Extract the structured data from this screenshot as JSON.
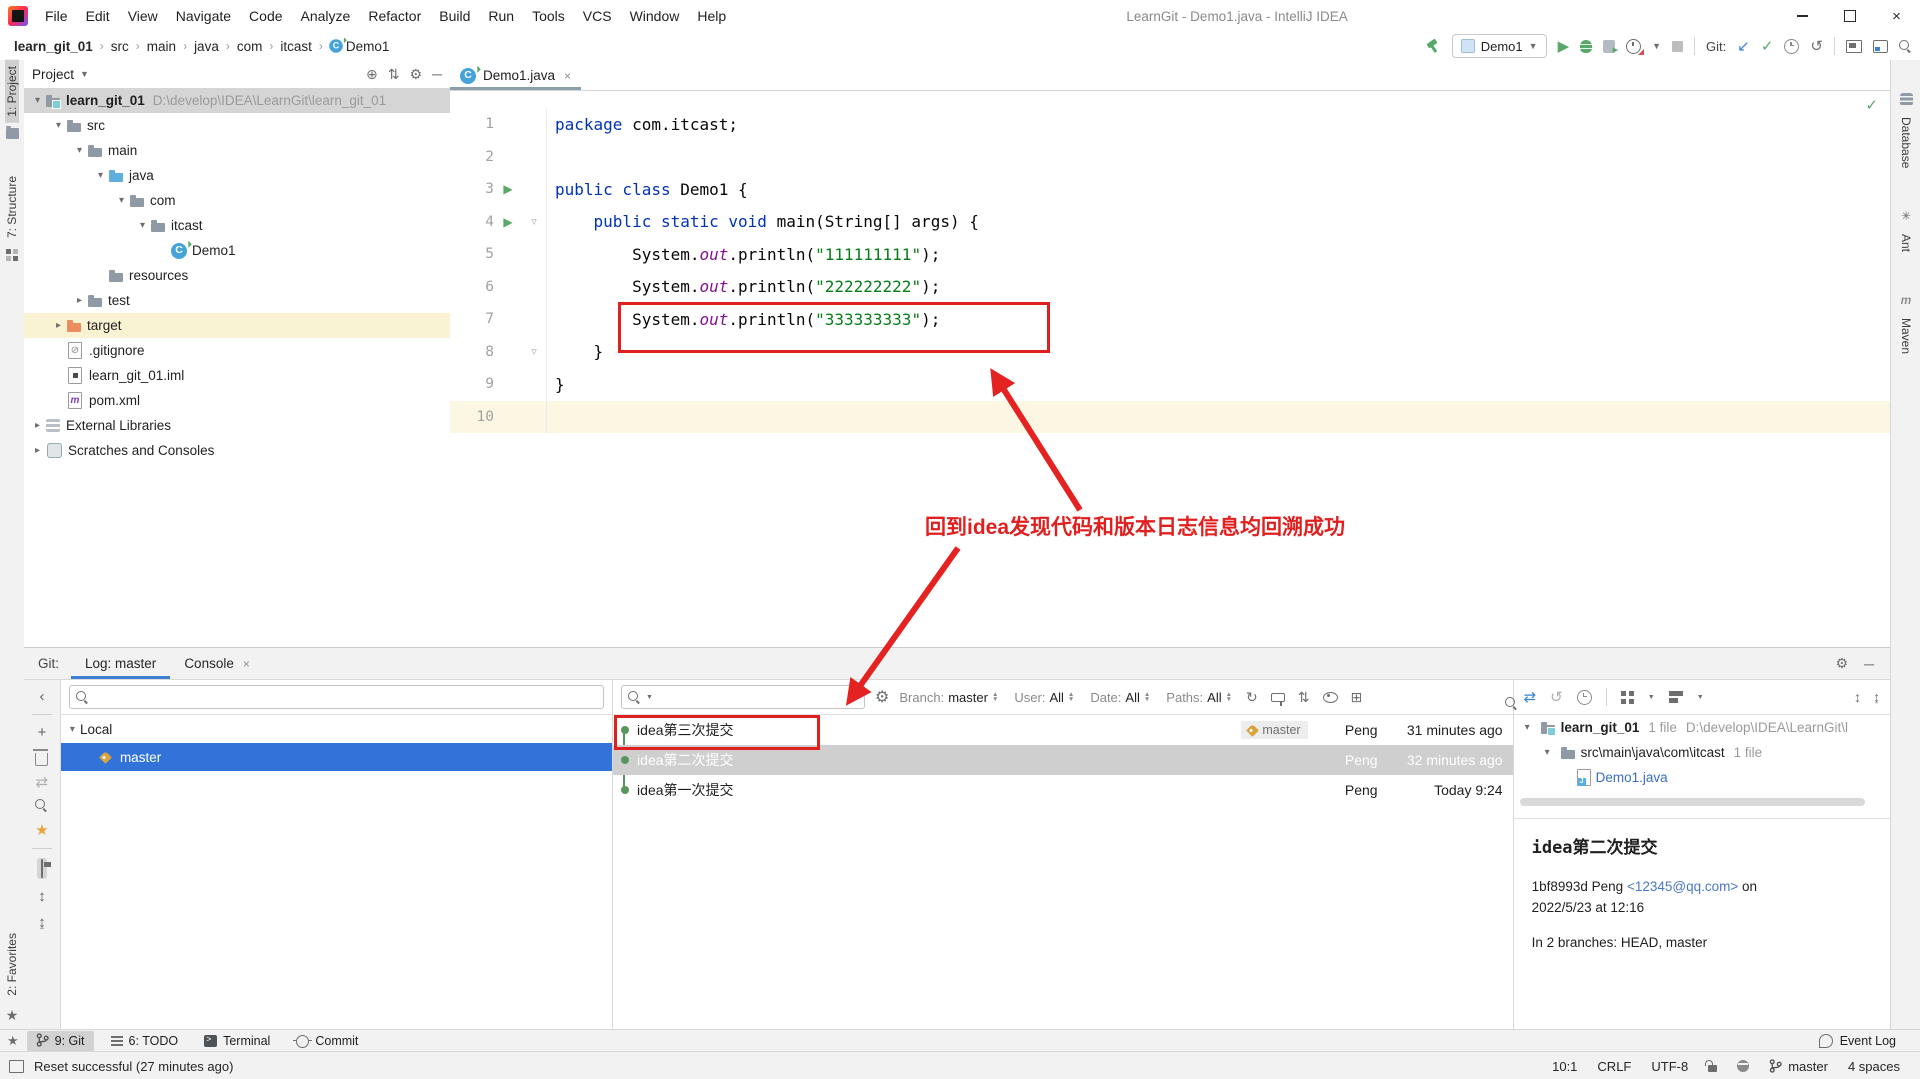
{
  "window": {
    "title": "LearnGit - Demo1.java - IntelliJ IDEA",
    "menus": [
      "File",
      "Edit",
      "View",
      "Navigate",
      "Code",
      "Analyze",
      "Refactor",
      "Build",
      "Run",
      "Tools",
      "VCS",
      "Window",
      "Help"
    ]
  },
  "breadcrumbs": [
    "learn_git_01",
    "src",
    "main",
    "java",
    "com",
    "itcast",
    "Demo1"
  ],
  "toolbar": {
    "run_config": "Demo1",
    "git_label": "Git:"
  },
  "stripes": {
    "project": "1: Project",
    "structure": "7: Structure",
    "favorites": "2: Favorites",
    "database": "Database",
    "ant": "Ant",
    "maven": "Maven"
  },
  "project_panel": {
    "title": "Project",
    "items": [
      {
        "label": "learn_git_01",
        "hint": "D:\\develop\\IDEA\\LearnGit\\learn_git_01",
        "level": 0,
        "icon": "project",
        "arrow": "open",
        "selected": true,
        "bold": true
      },
      {
        "label": "src",
        "level": 1,
        "icon": "folder",
        "arrow": "open"
      },
      {
        "label": "main",
        "level": 2,
        "icon": "folder",
        "arrow": "open"
      },
      {
        "label": "java",
        "level": 3,
        "icon": "src-folder",
        "arrow": "open"
      },
      {
        "label": "com",
        "level": 4,
        "icon": "package",
        "arrow": "open"
      },
      {
        "label": "itcast",
        "level": 5,
        "icon": "package",
        "arrow": "open"
      },
      {
        "label": "Demo1",
        "level": 6,
        "icon": "class"
      },
      {
        "label": "resources",
        "level": 3,
        "icon": "res-folder"
      },
      {
        "label": "test",
        "level": 2,
        "icon": "folder",
        "arrow": "closed"
      },
      {
        "label": "target",
        "level": 1,
        "icon": "excluded",
        "arrow": "closed",
        "highlighted": true
      },
      {
        "label": ".gitignore",
        "level": 1,
        "icon": "ignore"
      },
      {
        "label": "learn_git_01.iml",
        "level": 1,
        "icon": "iml"
      },
      {
        "label": "pom.xml",
        "level": 1,
        "icon": "maven-file"
      },
      {
        "label": "External Libraries",
        "level": 0,
        "icon": "libs",
        "arrow": "closed"
      },
      {
        "label": "Scratches and Consoles",
        "level": 0,
        "icon": "scratch",
        "arrow": "closed"
      }
    ]
  },
  "editor": {
    "tab": "Demo1.java",
    "annotation": "回到idea发现代码和版本日志信息均回溯成功",
    "lines": [
      {
        "n": "1",
        "seg": [
          {
            "t": "package ",
            "c": "kw"
          },
          {
            "t": "com.itcast;",
            "c": "pl"
          }
        ]
      },
      {
        "n": "2",
        "seg": []
      },
      {
        "n": "3",
        "run": true,
        "seg": [
          {
            "t": "public class ",
            "c": "kw"
          },
          {
            "t": "Demo1 {",
            "c": "pl"
          }
        ]
      },
      {
        "n": "4",
        "run": true,
        "fold": true,
        "seg": [
          {
            "t": "    ",
            "c": "pl"
          },
          {
            "t": "public static void ",
            "c": "kw"
          },
          {
            "t": "main(String[] args) {",
            "c": "pl"
          }
        ]
      },
      {
        "n": "5",
        "seg": [
          {
            "t": "        System.",
            "c": "pl"
          },
          {
            "t": "out",
            "c": "fld"
          },
          {
            "t": ".println(",
            "c": "pl"
          },
          {
            "t": "\"111111111\"",
            "c": "str"
          },
          {
            "t": ");",
            "c": "pl"
          }
        ]
      },
      {
        "n": "6",
        "seg": [
          {
            "t": "        System.",
            "c": "pl"
          },
          {
            "t": "out",
            "c": "fld"
          },
          {
            "t": ".println(",
            "c": "pl"
          },
          {
            "t": "\"222222222\"",
            "c": "str"
          },
          {
            "t": ");",
            "c": "pl"
          }
        ]
      },
      {
        "n": "7",
        "seg": [
          {
            "t": "        System.",
            "c": "pl"
          },
          {
            "t": "out",
            "c": "fld"
          },
          {
            "t": ".println(",
            "c": "pl"
          },
          {
            "t": "\"333333333\"",
            "c": "str"
          },
          {
            "t": ");",
            "c": "pl"
          }
        ]
      },
      {
        "n": "8",
        "fold": true,
        "seg": [
          {
            "t": "    }",
            "c": "pl"
          }
        ]
      },
      {
        "n": "9",
        "seg": [
          {
            "t": "}",
            "c": "pl"
          }
        ]
      },
      {
        "n": "10",
        "caret": true,
        "seg": []
      }
    ]
  },
  "git_panel": {
    "label": "Git:",
    "tabs": [
      {
        "label": "Log: master",
        "active": true
      },
      {
        "label": "Console",
        "closable": true
      }
    ],
    "branches": {
      "root": "Local",
      "items": [
        {
          "label": "master",
          "selected": true
        }
      ]
    },
    "filters": [
      {
        "label": "Branch:",
        "value": "master"
      },
      {
        "label": "User:",
        "value": "All"
      },
      {
        "label": "Date:",
        "value": "All"
      },
      {
        "label": "Paths:",
        "value": "All"
      }
    ],
    "commits": [
      {
        "message": "idea第三次提交",
        "tag": "master",
        "author": "Peng",
        "time": "31 minutes ago",
        "boxed": true
      },
      {
        "message": "idea第二次提交",
        "author": "Peng",
        "time": "32 minutes ago",
        "selected": true
      },
      {
        "message": "idea第一次提交",
        "author": "Peng",
        "time": "Today 9:24"
      }
    ],
    "changed_files": {
      "root": "learn_git_01",
      "root_count": "1 file",
      "root_path": "D:\\develop\\IDEA\\LearnGit\\l",
      "dir": "src\\main\\java\\com\\itcast",
      "dir_count": "1 file",
      "file": "Demo1.java"
    },
    "details": {
      "title": "idea第二次提交",
      "hash_author": "1bf8993d Peng",
      "email": "<12345@qq.com>",
      "suffix": "on 2022/5/23 at 12:16",
      "branches": "In 2 branches: HEAD, master"
    }
  },
  "bottom_bar": {
    "items": [
      {
        "label": "9: Git",
        "active": true,
        "icon": "git"
      },
      {
        "label": "6: TODO",
        "icon": "todo"
      },
      {
        "label": "Terminal",
        "icon": "terminal"
      },
      {
        "label": "Commit",
        "icon": "commit"
      }
    ],
    "event_log": "Event Log"
  },
  "status_bar": {
    "message": "Reset successful (27 minutes ago)",
    "position": "10:1",
    "line_sep": "CRLF",
    "encoding": "UTF-8",
    "branch": "master",
    "indent": "4 spaces"
  }
}
